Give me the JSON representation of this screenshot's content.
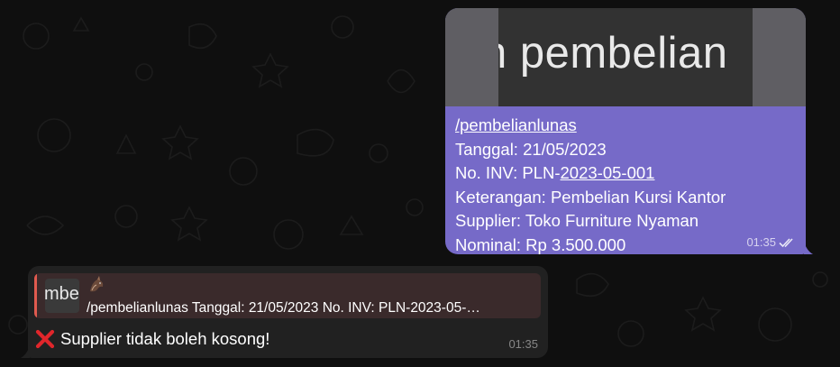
{
  "outgoing": {
    "media_text": "n pembelian",
    "lines": [
      {
        "text": "/pembelianlunas",
        "link": true
      },
      {
        "prefix": "Tanggal: 21/05/2023"
      },
      {
        "prefix": "No. INV: PLN-",
        "link_part": "2023-05-001"
      },
      {
        "prefix": "Keterangan: Pembelian Kursi Kantor"
      },
      {
        "prefix": "Supplier: Toko Furniture Nyaman"
      },
      {
        "prefix": "Nominal: Rp 3.500.000"
      }
    ],
    "time": "01:35",
    "status_icon": "double-check-icon"
  },
  "incoming": {
    "reply": {
      "thumb_text": "mbel",
      "sender_icon": "fox-emoji-icon",
      "preview": "/pembelianlunas Tanggal: 21/05/2023 No. INV: PLN-2023-05-…"
    },
    "status_icon": "cross-mark-icon",
    "text": "Supplier tidak boleh kosong!",
    "time": "01:35"
  },
  "colors": {
    "outgoing_bubble": "#766ac8",
    "incoming_bubble": "#212121",
    "reply_bar": "#e05a4f",
    "background": "#0f0f0f"
  }
}
